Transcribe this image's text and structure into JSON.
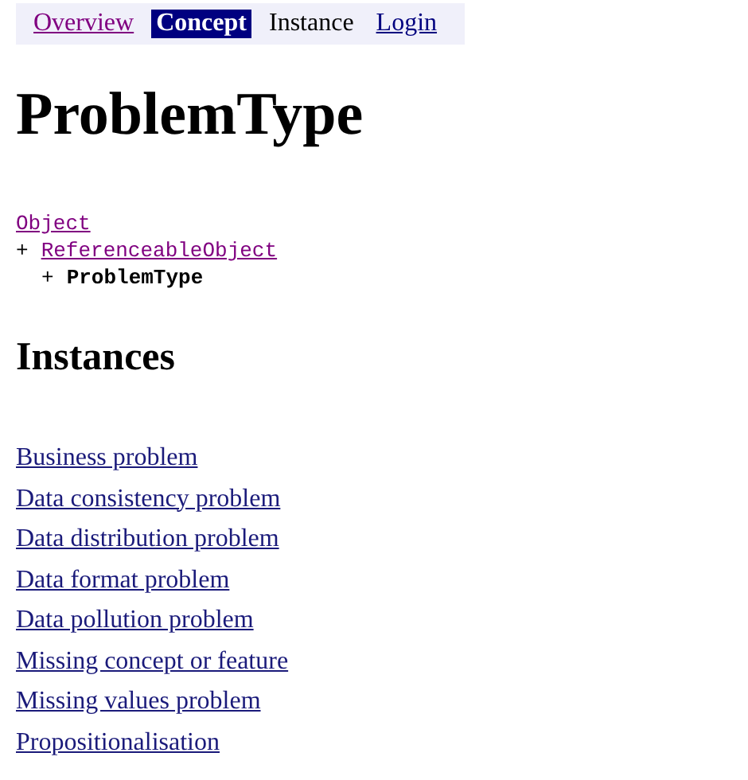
{
  "nav": [
    {
      "label": "Overview",
      "kind": "visited",
      "selected": false
    },
    {
      "label": "Concept",
      "selected": true
    },
    {
      "label": "Instance",
      "kind": "text",
      "selected": false
    },
    {
      "label": "Login",
      "kind": "link",
      "selected": false
    }
  ],
  "title": "ProblemType",
  "hierarchy": [
    {
      "label": "Object",
      "kind": "visited",
      "children": [
        {
          "marker": "+",
          "label": "ReferenceableObject",
          "kind": "visited",
          "children": [
            {
              "marker": "+",
              "label": "ProblemType",
              "kind": "current"
            }
          ]
        }
      ]
    }
  ],
  "instances_heading": "Instances",
  "instances": [
    "Business problem",
    "Data consistency problem",
    "Data distribution problem",
    "Data format problem",
    "Data pollution problem",
    "Missing concept or feature",
    "Missing values problem",
    "Propositionalisation"
  ]
}
